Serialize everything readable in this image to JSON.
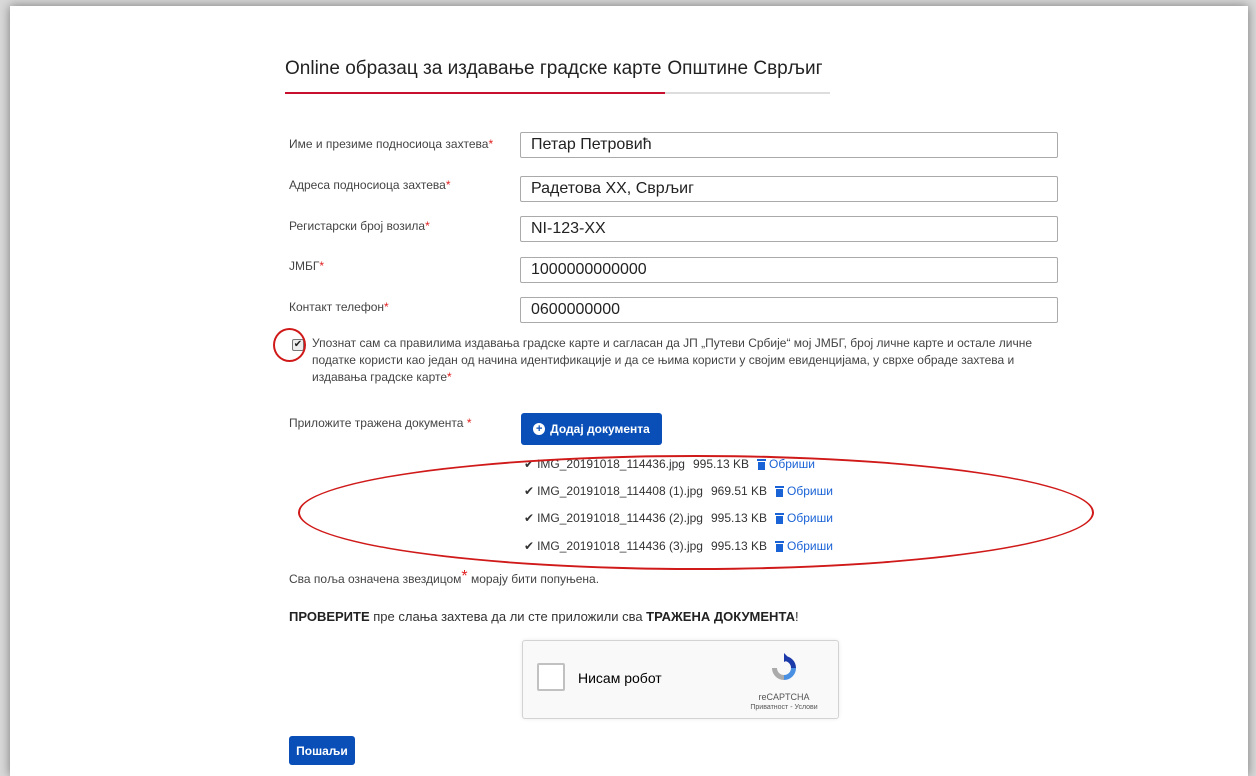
{
  "form": {
    "title_regular": "Online образац за издавање градске карте",
    "title_strong": "Општине Сврљиг",
    "fields": [
      {
        "label": "Име и презиме подносиоца захтева",
        "value": "Петар Петровић"
      },
      {
        "label": "Адреса подносиоца захтева",
        "value": "Радетова XX, Сврљиг"
      },
      {
        "label": "Регистарски број возила",
        "value": "NI-123-XX"
      },
      {
        "label": "ЈМБГ",
        "value": "1000000000000"
      },
      {
        "label": "Контакт телефон",
        "value": "0600000000"
      }
    ],
    "required_mark": "*",
    "consent_text": "Упознат сам са правилима издавања градске карте и сагласан да ЈП „Путеви Србије“ мој ЈМБГ, број личне карте и остале личне податке користи као један од начина идентификације и да се њима користи у својим евиденцијама, у сврхе обраде захтева и издавања градске карте",
    "consent_checked": true,
    "attach_label": "Приложите тражена документа",
    "add_button": "Додај документа",
    "files": [
      {
        "name": "IMG_20191018_114436.jpg",
        "size": "995.13 KB",
        "delete": "Обриши"
      },
      {
        "name": "IMG_20191018_114408 (1).jpg",
        "size": "969.51 KB",
        "delete": "Обриши"
      },
      {
        "name": "IMG_20191018_114436 (2).jpg",
        "size": "995.13 KB",
        "delete": "Обриши"
      },
      {
        "name": "IMG_20191018_114436 (3).jpg",
        "size": "995.13 KB",
        "delete": "Обриши"
      }
    ],
    "note_before": "Сва поља означена звездицом",
    "note_after": " морају бити попуњена.",
    "check_strong1": "ПРОВЕРИТЕ",
    "check_mid": " пре слања захтева да ли сте приложили сва ",
    "check_strong2": "ТРАЖЕНА ДОКУМЕНТА",
    "check_end": "!",
    "captcha_label": "Нисам робот",
    "captcha_brand": "reCAPTCHA",
    "captcha_legal": "Приватност - Услови",
    "submit_button": "Пошаљи"
  },
  "colors": {
    "accent": "#c8102e",
    "button": "#0a4fb8",
    "link": "#1a63d6",
    "annotation": "#d01919"
  }
}
